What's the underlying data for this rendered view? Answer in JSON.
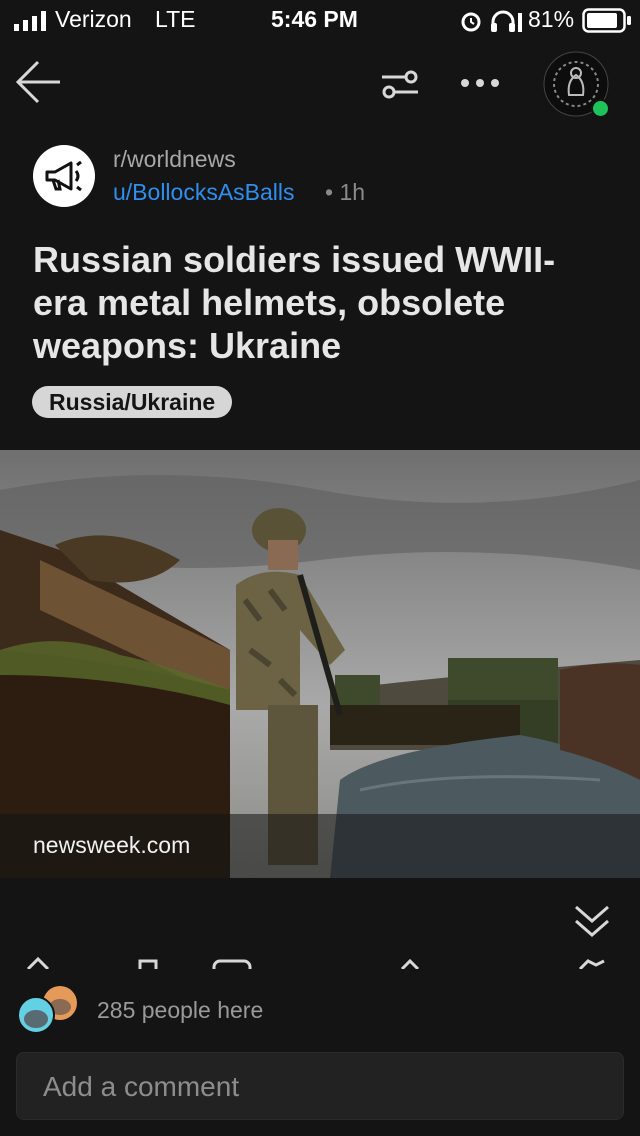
{
  "status_bar": {
    "carrier": "Verizon",
    "network": "LTE",
    "time": "5:46 PM",
    "battery": "81%"
  },
  "post": {
    "subreddit": "r/worldnews",
    "author": "u/BollocksAsBalls",
    "age": "• 1h",
    "title": "Russian soldiers issued WWII-era metal helmets, obsolete weapons: Ukraine",
    "flair": "Russia/Ukraine",
    "link_domain": "newsweek.com"
  },
  "presence": {
    "count_text": "285 people here"
  },
  "comment": {
    "placeholder": "Add a comment"
  },
  "colors": {
    "accent_blue": "#2f8ff0",
    "online_green": "#1ec45a",
    "background": "#141414"
  },
  "icons": [
    "back-arrow-icon",
    "filter-sliders-icon",
    "more-dots-icon",
    "megaphone-icon",
    "chevrons-down-icon"
  ]
}
